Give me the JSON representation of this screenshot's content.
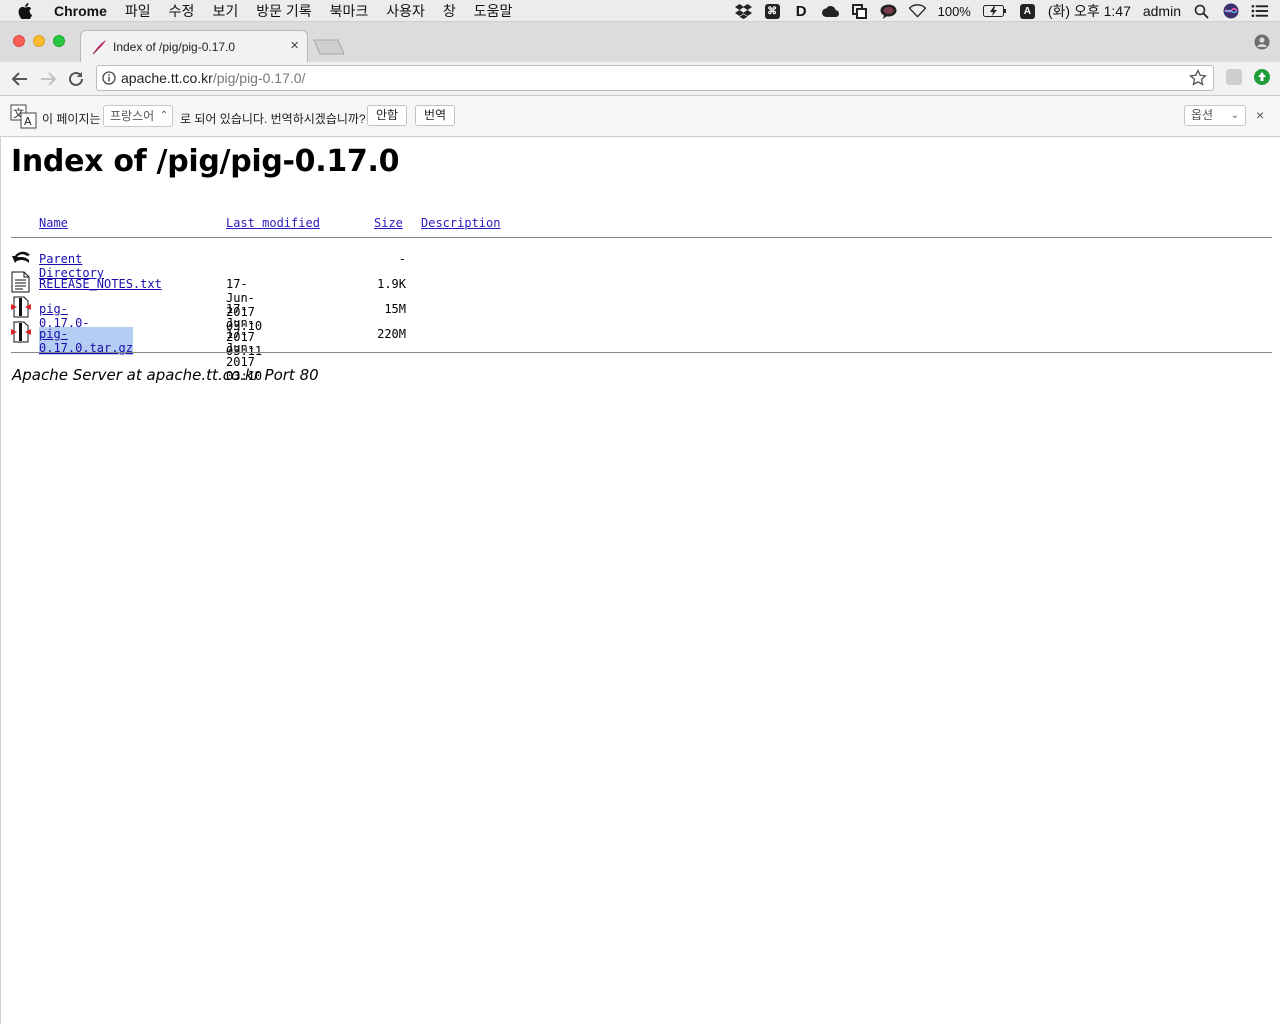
{
  "menubar": {
    "app_name": "Chrome",
    "items": [
      "파일",
      "수정",
      "보기",
      "방문 기록",
      "북마크",
      "사용자",
      "창",
      "도움말"
    ],
    "battery": "100%",
    "input_source": "A",
    "clock": "(화) 오후 1:47",
    "user": "admin"
  },
  "browser": {
    "tab_title": "Index of /pig/pig-0.17.0",
    "tab_close": "×",
    "url_host": "apache.tt.co.kr",
    "url_path": "/pig/pig-0.17.0/"
  },
  "translate_bar": {
    "prefix": "이 페이지는",
    "language": "프랑스어",
    "suffix": "로 되어 있습니다. 번역하시겠습니까?",
    "decline_label": "안함",
    "translate_label": "번역",
    "options_label": "옵션",
    "close": "×"
  },
  "page": {
    "heading": "Index of /pig/pig-0.17.0",
    "columns": {
      "name": "Name",
      "last_modified": "Last modified",
      "size": "Size",
      "description": "Description"
    },
    "rows": [
      {
        "name": "Parent Directory",
        "date": "",
        "size": "-",
        "icon": "back-icon"
      },
      {
        "name": "RELEASE_NOTES.txt",
        "date": "17-Jun-2017 03:10",
        "size": "1.9K",
        "icon": "text-file-icon"
      },
      {
        "name": "pig-0.17.0-src.tar.gz",
        "date": "17-Jun-2017 03:11",
        "size": "15M",
        "icon": "compressed-file-icon"
      },
      {
        "name": "pig-0.17.0.tar.gz",
        "date": "17-Jun-2017 03:10",
        "size": "220M",
        "icon": "compressed-file-icon"
      }
    ],
    "footer": "Apache Server at apache.tt.co.kr Port 80"
  }
}
